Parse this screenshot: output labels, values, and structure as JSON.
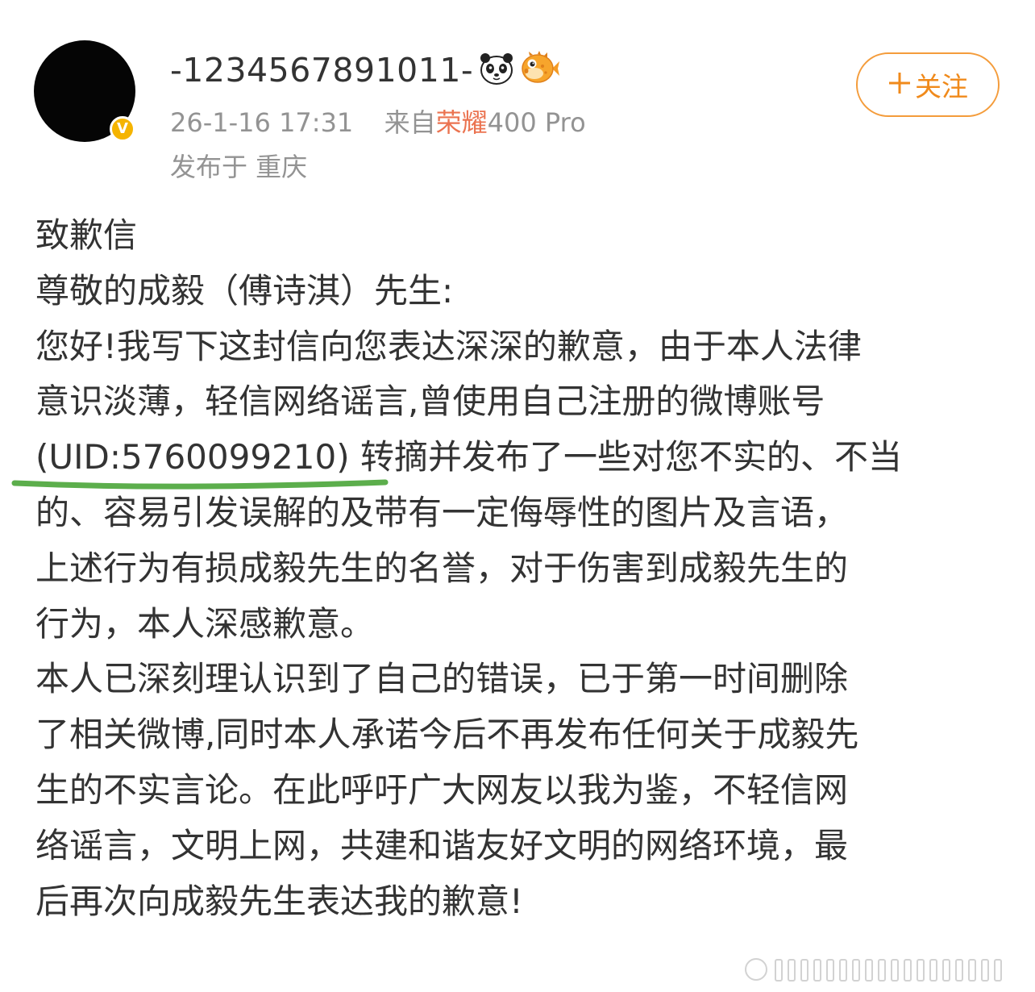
{
  "post": {
    "username": "-1234567891011-",
    "username_emojis": [
      "panda-emoji-icon",
      "pufferfish-emoji-icon"
    ],
    "timestamp": "26-1-16 17:31",
    "source_prefix": "来自",
    "source_brand": "荣耀",
    "source_model": "400 Pro",
    "location": "发布于  重庆",
    "follow_label": "关注",
    "verified_badge": "V",
    "body_lines": [
      "致歉信",
      "尊敬的成毅（傅诗淇）先生:",
      "您好!我写下这封信向您表达深深的歉意，由于本人法律",
      "意识淡薄，轻信网络谣言,曾使用自己注册的微博账号",
      "(UID:5760099210) 转摘并发布了一些对您不实的、不当",
      "的、容易引发误解的及带有一定侮辱性的图片及言语，",
      "上述行为有损成毅先生的名誉，对于伤害到成毅先生的",
      "行为，本人深感歉意。",
      "本人已深刻理认识到了自己的错误，已于第一时间删除",
      "了相关微博,同时本人承诺今后不再发布任何关于成毅先",
      "生的不实言论。在此呼吁广大网友以我为鉴，不轻信网",
      "络谣言，文明上网，共建和谐友好文明的网络环境，最",
      "后再次向成毅先生表达我的歉意!"
    ]
  },
  "colors": {
    "accent_orange": "#f08a1b",
    "meta_gray": "#939393",
    "source_link": "#eb7350",
    "highlight_green": "#4caf50",
    "badge_yellow": "#f5b400"
  }
}
